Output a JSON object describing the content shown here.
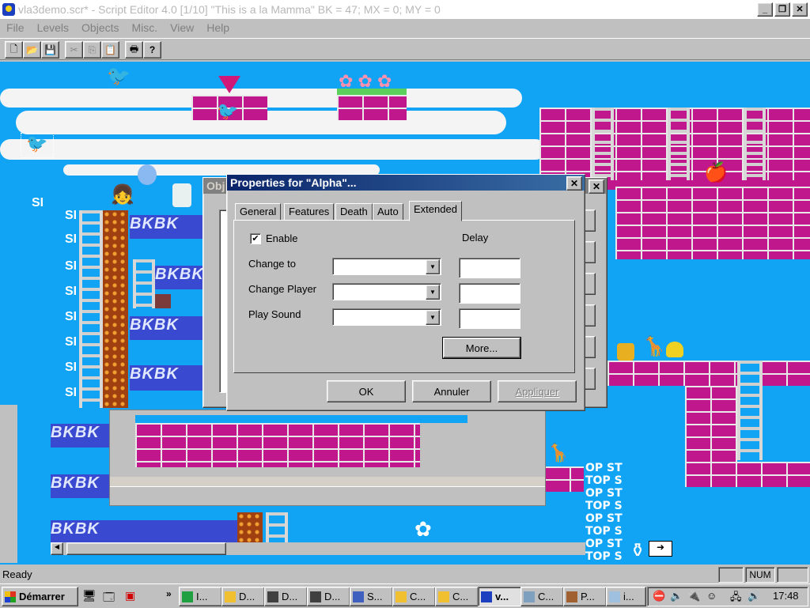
{
  "window": {
    "title": "vla3demo.scr* - Script Editor 4.0 [1/10] \"This is a la Mamma\" BK = 47; MX = 0; MY = 0"
  },
  "menu": [
    "File",
    "Levels",
    "Objects",
    "Misc.",
    "View",
    "Help"
  ],
  "toolbar_icons": [
    "new-icon",
    "open-icon",
    "save-icon",
    "cut-icon",
    "copy-icon",
    "paste-icon",
    "print-icon",
    "help-icon"
  ],
  "scene": {
    "bk_text": "BKBK",
    "stop_text": "OP ST",
    "stop_text2": "TOP S",
    "snake_glyph": "ЅI"
  },
  "back_dialog": {
    "title": "Obj"
  },
  "dialog": {
    "title": "Properties for \"Alpha\"...",
    "tabs": [
      "General",
      "Features",
      "Death",
      "Auto",
      "Extended"
    ],
    "active_tab": "Extended",
    "enable_label": "Enable",
    "enable_checked": true,
    "delay_label": "Delay",
    "rows": [
      {
        "label": "Change to",
        "value": "",
        "delay": ""
      },
      {
        "label": "Change Player",
        "value": "",
        "delay": ""
      },
      {
        "label": "Play Sound",
        "value": "",
        "delay": ""
      }
    ],
    "more_label": "More...",
    "ok_label": "OK",
    "cancel_label": "Annuler",
    "apply_label": "Appliquer"
  },
  "statusbar": {
    "text": "Ready",
    "num": "NUM"
  },
  "taskbar": {
    "start_label": "Démarrer",
    "tasks": [
      {
        "label": "I...",
        "icon": "app-icon"
      },
      {
        "label": "D...",
        "icon": "folder-icon"
      },
      {
        "label": "D...",
        "icon": "archive-icon"
      },
      {
        "label": "D...",
        "icon": "archive-icon"
      },
      {
        "label": "S...",
        "icon": "network-icon"
      },
      {
        "label": "C...",
        "icon": "folder-icon"
      },
      {
        "label": "C...",
        "icon": "folder-icon"
      },
      {
        "label": "v...",
        "icon": "app-icon"
      },
      {
        "label": "C...",
        "icon": "control-panel-icon"
      },
      {
        "label": "P...",
        "icon": "paint-icon"
      },
      {
        "label": "i...",
        "icon": "document-icon"
      }
    ],
    "clock": "17:48"
  },
  "colors": {
    "title_active": "#0a246a",
    "face": "#c0c0c0",
    "sky": "#12a4f4",
    "brick": "#c0188c"
  }
}
